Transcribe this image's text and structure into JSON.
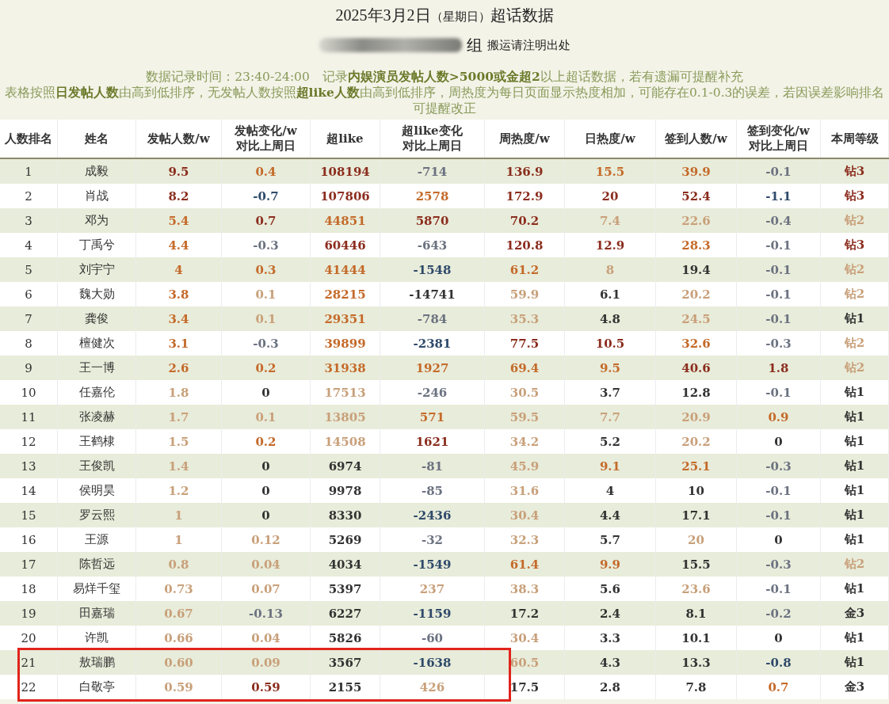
{
  "title": {
    "date": "2025年3月2日",
    "weekday": "（星期日）",
    "suffix": "超话数据"
  },
  "subtitle": {
    "group": "组",
    "note": "搬运请注明出处"
  },
  "notes": [
    "数据记录时间：23:40-24:00　记录**内娱演员发帖人数>5000或金超2**以上超话数据，若有遗漏可提醒补充",
    "表格按照**日发帖人数**由高到低排序，无发帖人数按照**超like人数**由高到低排序，周热度为每日页面显示热度相加，可能存在0.1-0.3的误差，若因误差影响排名可提醒改正"
  ],
  "table": {
    "columns": [
      [
        "人数排名"
      ],
      [
        "姓名"
      ],
      [
        "发帖人数/w"
      ],
      [
        "发帖变化/w",
        "对比上周日"
      ],
      [
        "超like"
      ],
      [
        "超like变化",
        "对比上周日"
      ],
      [
        "周热度/w"
      ],
      [
        "日热度/w"
      ],
      [
        "签到人数/w"
      ],
      [
        "签到变化/w",
        "对比上周日"
      ],
      [
        "本周等级"
      ]
    ],
    "rows": [
      {
        "rank": "1",
        "name": "成毅",
        "highlighted": false,
        "values": [
          {
            "text": "9.5",
            "color": "#8b2d1e"
          },
          {
            "text": "0.4",
            "color": "#c46a2a"
          },
          {
            "text": "108194",
            "color": "#8b2d1e"
          },
          {
            "text": "-714",
            "color": "#6b7280"
          },
          {
            "text": "136.9",
            "color": "#8b2d1e"
          },
          {
            "text": "15.5",
            "color": "#c46a2a"
          },
          {
            "text": "39.9",
            "color": "#c46a2a"
          },
          {
            "text": "-0.1",
            "color": "#6b7280"
          },
          {
            "text": "钻3",
            "color": "#8b2d1e"
          }
        ]
      },
      {
        "rank": "2",
        "name": "肖战",
        "highlighted": false,
        "values": [
          {
            "text": "8.2",
            "color": "#8b2d1e"
          },
          {
            "text": "-0.7",
            "color": "#2f4a6a"
          },
          {
            "text": "107806",
            "color": "#8b2d1e"
          },
          {
            "text": "2578",
            "color": "#c46a2a"
          },
          {
            "text": "172.9",
            "color": "#8b2d1e"
          },
          {
            "text": "20",
            "color": "#8b2d1e"
          },
          {
            "text": "52.4",
            "color": "#8b2d1e"
          },
          {
            "text": "-1.1",
            "color": "#2f4a6a"
          },
          {
            "text": "钻3",
            "color": "#8b2d1e"
          }
        ]
      },
      {
        "rank": "3",
        "name": "邓为",
        "highlighted": false,
        "values": [
          {
            "text": "5.4",
            "color": "#c46a2a"
          },
          {
            "text": "0.7",
            "color": "#8b2d1e"
          },
          {
            "text": "44851",
            "color": "#c46a2a"
          },
          {
            "text": "5870",
            "color": "#8b2d1e"
          },
          {
            "text": "70.2",
            "color": "#8b2d1e"
          },
          {
            "text": "7.4",
            "color": "#c8a07a"
          },
          {
            "text": "22.6",
            "color": "#c8a07a"
          },
          {
            "text": "-0.4",
            "color": "#6b7280"
          },
          {
            "text": "钻2",
            "color": "#c8a07a"
          }
        ]
      },
      {
        "rank": "4",
        "name": "丁禹兮",
        "highlighted": false,
        "values": [
          {
            "text": "4.4",
            "color": "#c46a2a"
          },
          {
            "text": "-0.3",
            "color": "#6b7280"
          },
          {
            "text": "60446",
            "color": "#8b2d1e"
          },
          {
            "text": "-643",
            "color": "#6b7280"
          },
          {
            "text": "120.8",
            "color": "#8b2d1e"
          },
          {
            "text": "12.9",
            "color": "#8b2d1e"
          },
          {
            "text": "28.3",
            "color": "#c46a2a"
          },
          {
            "text": "-0.1",
            "color": "#6b7280"
          },
          {
            "text": "钻3",
            "color": "#8b2d1e"
          }
        ]
      },
      {
        "rank": "5",
        "name": "刘宇宁",
        "highlighted": false,
        "values": [
          {
            "text": "4",
            "color": "#c46a2a"
          },
          {
            "text": "0.3",
            "color": "#c46a2a"
          },
          {
            "text": "41444",
            "color": "#c46a2a"
          },
          {
            "text": "-1548",
            "color": "#2f4a6a"
          },
          {
            "text": "61.2",
            "color": "#c46a2a"
          },
          {
            "text": "8",
            "color": "#c8a07a"
          },
          {
            "text": "19.4",
            "color": "#333333"
          },
          {
            "text": "-0.1",
            "color": "#6b7280"
          },
          {
            "text": "钻2",
            "color": "#c8a07a"
          }
        ]
      },
      {
        "rank": "6",
        "name": "魏大勋",
        "highlighted": false,
        "values": [
          {
            "text": "3.8",
            "color": "#c46a2a"
          },
          {
            "text": "0.1",
            "color": "#c8a07a"
          },
          {
            "text": "28215",
            "color": "#c46a2a"
          },
          {
            "text": "-14741",
            "color": "#333333"
          },
          {
            "text": "59.9",
            "color": "#c8a07a"
          },
          {
            "text": "6.1",
            "color": "#333333"
          },
          {
            "text": "20.2",
            "color": "#c8a07a"
          },
          {
            "text": "-0.1",
            "color": "#6b7280"
          },
          {
            "text": "钻2",
            "color": "#c8a07a"
          }
        ]
      },
      {
        "rank": "7",
        "name": "龚俊",
        "highlighted": false,
        "values": [
          {
            "text": "3.4",
            "color": "#c46a2a"
          },
          {
            "text": "0.1",
            "color": "#c8a07a"
          },
          {
            "text": "29351",
            "color": "#c46a2a"
          },
          {
            "text": "-784",
            "color": "#6b7280"
          },
          {
            "text": "35.3",
            "color": "#c8a07a"
          },
          {
            "text": "4.8",
            "color": "#333333"
          },
          {
            "text": "24.5",
            "color": "#c8a07a"
          },
          {
            "text": "-0.1",
            "color": "#6b7280"
          },
          {
            "text": "钻1",
            "color": "#333333"
          }
        ]
      },
      {
        "rank": "8",
        "name": "檀健次",
        "highlighted": false,
        "values": [
          {
            "text": "3.1",
            "color": "#c46a2a"
          },
          {
            "text": "-0.3",
            "color": "#6b7280"
          },
          {
            "text": "39899",
            "color": "#c46a2a"
          },
          {
            "text": "-2381",
            "color": "#2f4a6a"
          },
          {
            "text": "77.5",
            "color": "#8b2d1e"
          },
          {
            "text": "10.5",
            "color": "#8b2d1e"
          },
          {
            "text": "32.6",
            "color": "#c46a2a"
          },
          {
            "text": "-0.3",
            "color": "#6b7280"
          },
          {
            "text": "钻2",
            "color": "#c8a07a"
          }
        ]
      },
      {
        "rank": "9",
        "name": "王一博",
        "highlighted": false,
        "values": [
          {
            "text": "2.6",
            "color": "#c46a2a"
          },
          {
            "text": "0.2",
            "color": "#c46a2a"
          },
          {
            "text": "31938",
            "color": "#c46a2a"
          },
          {
            "text": "1927",
            "color": "#c46a2a"
          },
          {
            "text": "69.4",
            "color": "#c46a2a"
          },
          {
            "text": "9.5",
            "color": "#c46a2a"
          },
          {
            "text": "40.6",
            "color": "#8b2d1e"
          },
          {
            "text": "1.8",
            "color": "#8b2d1e"
          },
          {
            "text": "钻2",
            "color": "#c8a07a"
          }
        ]
      },
      {
        "rank": "10",
        "name": "任嘉伦",
        "highlighted": false,
        "values": [
          {
            "text": "1.8",
            "color": "#c8a07a"
          },
          {
            "text": "0",
            "color": "#333333"
          },
          {
            "text": "17513",
            "color": "#c8a07a"
          },
          {
            "text": "-246",
            "color": "#6b7280"
          },
          {
            "text": "30.5",
            "color": "#c8a07a"
          },
          {
            "text": "3.7",
            "color": "#333333"
          },
          {
            "text": "12.8",
            "color": "#333333"
          },
          {
            "text": "-0.1",
            "color": "#6b7280"
          },
          {
            "text": "钻1",
            "color": "#333333"
          }
        ]
      },
      {
        "rank": "11",
        "name": "张凌赫",
        "highlighted": false,
        "values": [
          {
            "text": "1.7",
            "color": "#c8a07a"
          },
          {
            "text": "0.1",
            "color": "#c8a07a"
          },
          {
            "text": "13805",
            "color": "#c8a07a"
          },
          {
            "text": "571",
            "color": "#c46a2a"
          },
          {
            "text": "59.5",
            "color": "#c8a07a"
          },
          {
            "text": "7.7",
            "color": "#c8a07a"
          },
          {
            "text": "20.9",
            "color": "#c8a07a"
          },
          {
            "text": "0.9",
            "color": "#c46a2a"
          },
          {
            "text": "钻1",
            "color": "#333333"
          }
        ]
      },
      {
        "rank": "12",
        "name": "王鹤棣",
        "highlighted": false,
        "values": [
          {
            "text": "1.5",
            "color": "#c8a07a"
          },
          {
            "text": "0.2",
            "color": "#c46a2a"
          },
          {
            "text": "14508",
            "color": "#c8a07a"
          },
          {
            "text": "1621",
            "color": "#8b2d1e"
          },
          {
            "text": "34.2",
            "color": "#c8a07a"
          },
          {
            "text": "5.2",
            "color": "#333333"
          },
          {
            "text": "20.2",
            "color": "#c8a07a"
          },
          {
            "text": "0",
            "color": "#333333"
          },
          {
            "text": "钻1",
            "color": "#333333"
          }
        ]
      },
      {
        "rank": "13",
        "name": "王俊凯",
        "highlighted": false,
        "values": [
          {
            "text": "1.4",
            "color": "#c8a07a"
          },
          {
            "text": "0",
            "color": "#333333"
          },
          {
            "text": "6974",
            "color": "#333333"
          },
          {
            "text": "-81",
            "color": "#6b7280"
          },
          {
            "text": "45.9",
            "color": "#c8a07a"
          },
          {
            "text": "9.1",
            "color": "#c46a2a"
          },
          {
            "text": "25.1",
            "color": "#c46a2a"
          },
          {
            "text": "-0.3",
            "color": "#6b7280"
          },
          {
            "text": "钻1",
            "color": "#333333"
          }
        ]
      },
      {
        "rank": "14",
        "name": "侯明昊",
        "highlighted": false,
        "values": [
          {
            "text": "1.2",
            "color": "#c8a07a"
          },
          {
            "text": "0",
            "color": "#333333"
          },
          {
            "text": "9978",
            "color": "#333333"
          },
          {
            "text": "-85",
            "color": "#6b7280"
          },
          {
            "text": "31.6",
            "color": "#c8a07a"
          },
          {
            "text": "4",
            "color": "#333333"
          },
          {
            "text": "10",
            "color": "#333333"
          },
          {
            "text": "-0.1",
            "color": "#6b7280"
          },
          {
            "text": "钻1",
            "color": "#333333"
          }
        ]
      },
      {
        "rank": "15",
        "name": "罗云熙",
        "highlighted": false,
        "values": [
          {
            "text": "1",
            "color": "#c8a07a"
          },
          {
            "text": "0",
            "color": "#333333"
          },
          {
            "text": "8330",
            "color": "#333333"
          },
          {
            "text": "-2436",
            "color": "#2f4a6a"
          },
          {
            "text": "30.4",
            "color": "#c8a07a"
          },
          {
            "text": "4.4",
            "color": "#333333"
          },
          {
            "text": "17.1",
            "color": "#333333"
          },
          {
            "text": "-0.1",
            "color": "#6b7280"
          },
          {
            "text": "钻1",
            "color": "#333333"
          }
        ]
      },
      {
        "rank": "16",
        "name": "王源",
        "highlighted": false,
        "values": [
          {
            "text": "1",
            "color": "#c8a07a"
          },
          {
            "text": "0.12",
            "color": "#c8a07a"
          },
          {
            "text": "5269",
            "color": "#333333"
          },
          {
            "text": "-32",
            "color": "#6b7280"
          },
          {
            "text": "32.3",
            "color": "#c8a07a"
          },
          {
            "text": "5.7",
            "color": "#333333"
          },
          {
            "text": "20",
            "color": "#c8a07a"
          },
          {
            "text": "0",
            "color": "#333333"
          },
          {
            "text": "钻1",
            "color": "#333333"
          }
        ]
      },
      {
        "rank": "17",
        "name": "陈哲远",
        "highlighted": false,
        "values": [
          {
            "text": "0.8",
            "color": "#c8a07a"
          },
          {
            "text": "0.04",
            "color": "#c8a07a"
          },
          {
            "text": "4034",
            "color": "#333333"
          },
          {
            "text": "-1549",
            "color": "#2f4a6a"
          },
          {
            "text": "61.4",
            "color": "#c46a2a"
          },
          {
            "text": "9.9",
            "color": "#c46a2a"
          },
          {
            "text": "15.5",
            "color": "#333333"
          },
          {
            "text": "-0.3",
            "color": "#6b7280"
          },
          {
            "text": "钻2",
            "color": "#c8a07a"
          }
        ]
      },
      {
        "rank": "18",
        "name": "易烊千玺",
        "highlighted": false,
        "values": [
          {
            "text": "0.73",
            "color": "#c8a07a"
          },
          {
            "text": "0.07",
            "color": "#c8a07a"
          },
          {
            "text": "5397",
            "color": "#333333"
          },
          {
            "text": "237",
            "color": "#c8a07a"
          },
          {
            "text": "38.3",
            "color": "#c8a07a"
          },
          {
            "text": "5.6",
            "color": "#333333"
          },
          {
            "text": "23.6",
            "color": "#c8a07a"
          },
          {
            "text": "-0.1",
            "color": "#6b7280"
          },
          {
            "text": "钻1",
            "color": "#333333"
          }
        ]
      },
      {
        "rank": "19",
        "name": "田嘉瑞",
        "highlighted": false,
        "values": [
          {
            "text": "0.67",
            "color": "#c8a07a"
          },
          {
            "text": "-0.13",
            "color": "#6b7280"
          },
          {
            "text": "6227",
            "color": "#333333"
          },
          {
            "text": "-1159",
            "color": "#2f4a6a"
          },
          {
            "text": "17.2",
            "color": "#333333"
          },
          {
            "text": "2.4",
            "color": "#333333"
          },
          {
            "text": "8.1",
            "color": "#333333"
          },
          {
            "text": "-0.2",
            "color": "#6b7280"
          },
          {
            "text": "金3",
            "color": "#333333"
          }
        ]
      },
      {
        "rank": "20",
        "name": "许凯",
        "highlighted": false,
        "values": [
          {
            "text": "0.66",
            "color": "#c8a07a"
          },
          {
            "text": "0.04",
            "color": "#c8a07a"
          },
          {
            "text": "5826",
            "color": "#333333"
          },
          {
            "text": "-60",
            "color": "#6b7280"
          },
          {
            "text": "30.4",
            "color": "#c8a07a"
          },
          {
            "text": "3.3",
            "color": "#333333"
          },
          {
            "text": "10.1",
            "color": "#333333"
          },
          {
            "text": "0",
            "color": "#333333"
          },
          {
            "text": "钻1",
            "color": "#333333"
          }
        ]
      },
      {
        "rank": "21",
        "name": "敖瑞鹏",
        "highlighted": true,
        "values": [
          {
            "text": "0.60",
            "color": "#c8a07a"
          },
          {
            "text": "0.09",
            "color": "#c8a07a"
          },
          {
            "text": "3567",
            "color": "#333333"
          },
          {
            "text": "-1638",
            "color": "#2f4a6a"
          },
          {
            "text": "60.5",
            "color": "#c8a07a"
          },
          {
            "text": "4.3",
            "color": "#333333"
          },
          {
            "text": "13.3",
            "color": "#333333"
          },
          {
            "text": "-0.8",
            "color": "#2f4a6a"
          },
          {
            "text": "钻1",
            "color": "#333333"
          }
        ]
      },
      {
        "rank": "22",
        "name": "白敬亭",
        "highlighted": true,
        "values": [
          {
            "text": "0.59",
            "color": "#c8a07a"
          },
          {
            "text": "0.59",
            "color": "#8b2d1e"
          },
          {
            "text": "2155",
            "color": "#333333"
          },
          {
            "text": "426",
            "color": "#c8a07a"
          },
          {
            "text": "17.5",
            "color": "#333333"
          },
          {
            "text": "2.8",
            "color": "#333333"
          },
          {
            "text": "7.8",
            "color": "#333333"
          },
          {
            "text": "0.7",
            "color": "#c46a2a"
          },
          {
            "text": "金3",
            "color": "#333333"
          }
        ]
      }
    ]
  }
}
